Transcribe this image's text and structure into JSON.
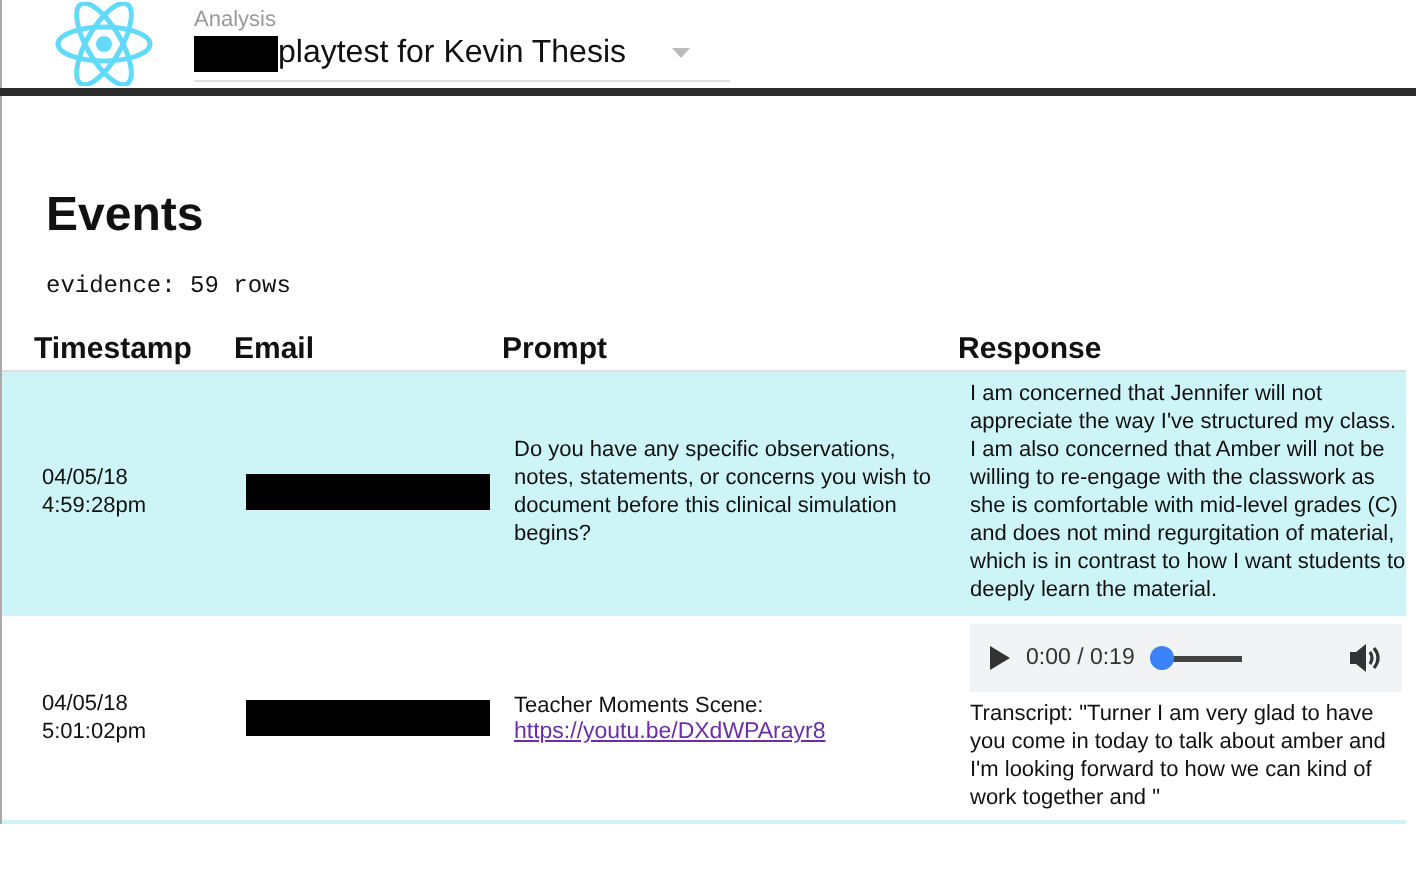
{
  "header": {
    "section_label": "Analysis",
    "selector": {
      "value": "playtest for Kevin Thesis"
    }
  },
  "title": "Events",
  "summary": "evidence: 59 rows",
  "table": {
    "columns": [
      "Timestamp",
      "Email",
      "Prompt",
      "Response"
    ],
    "rows": [
      {
        "selected": true,
        "date": "04/05/18",
        "time": "4:59:28pm",
        "prompt": {
          "text": "Do you have any specific observations, notes, statements, or concerns you wish to document before this clinical simulation begins?"
        },
        "response": {
          "kind": "text",
          "text": "I am concerned that Jennifer will not appreciate the way I've structured my class. I am also concerned that Amber will not be willing to re-engage with the classwork as she is comfortable with mid-level grades (C) and does not mind regurgitation of material, which is in contrast to how I want students to deeply learn the material."
        }
      },
      {
        "selected": false,
        "date": "04/05/18",
        "time": "5:01:02pm",
        "prompt": {
          "text": "Teacher Moments Scene:",
          "link": "https://youtu.be/DXdWPArayr8"
        },
        "response": {
          "kind": "audio",
          "time": "0:00 / 0:19",
          "level": 0,
          "text": "Transcript: \"Turner I am very glad to have you come in today to talk about amber and I'm looking forward to how we can kind of work together and \""
        }
      }
    ]
  }
}
